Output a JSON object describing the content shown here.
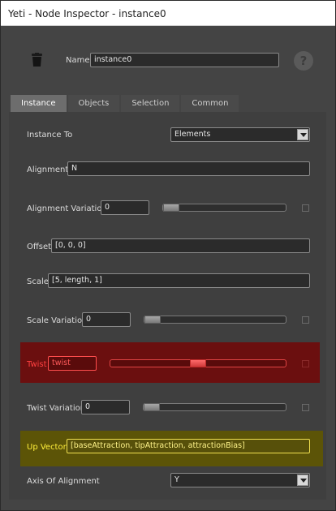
{
  "window": {
    "title": "Yeti - Node Inspector - instance0"
  },
  "header": {
    "name_label": "Name",
    "name_value": "instance0",
    "help_label": "?"
  },
  "tabs": [
    {
      "label": "Instance",
      "active": true
    },
    {
      "label": "Objects",
      "active": false
    },
    {
      "label": "Selection",
      "active": false
    },
    {
      "label": "Common",
      "active": false
    }
  ],
  "fields": {
    "instance_to": {
      "label": "Instance To",
      "value": "Elements"
    },
    "alignment": {
      "label": "Alignment",
      "value": "N"
    },
    "alignment_variation": {
      "label": "Alignment Variation",
      "value": "0",
      "slider_fraction": 0
    },
    "offset": {
      "label": "Offset",
      "value": "[0, 0, 0]"
    },
    "scale": {
      "label": "Scale",
      "value": "[5, length, 1]"
    },
    "scale_variation": {
      "label": "Scale Variation",
      "value": "0",
      "slider_fraction": 0
    },
    "twist": {
      "label": "Twist",
      "value": "twist",
      "slider_fraction": 0.5,
      "highlight": "#6b0f0f"
    },
    "twist_variation": {
      "label": "Twist Variation",
      "value": "0",
      "slider_fraction": 0
    },
    "up_vector": {
      "label": "Up Vector",
      "value": "[baseAttraction, tipAttraction, attractionBias]",
      "highlight": "#5c5407"
    },
    "axis_of_alignment": {
      "label": "Axis Of Alignment",
      "value": "Y"
    }
  },
  "icons": {
    "node": "trash-can-like-node-icon",
    "help": "question-mark-icon"
  }
}
